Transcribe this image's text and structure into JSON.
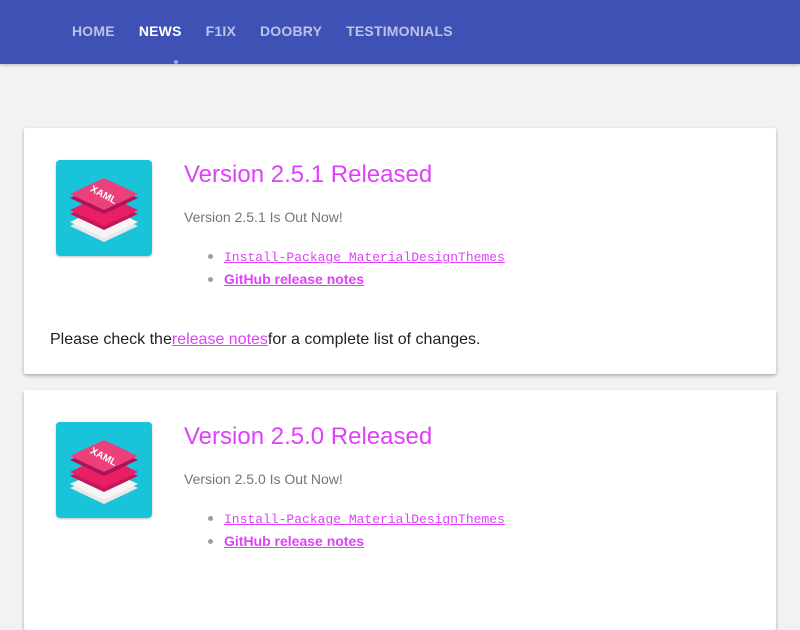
{
  "nav": {
    "items": [
      {
        "label": "HOME"
      },
      {
        "label": "NEWS"
      },
      {
        "label": "F1IX"
      },
      {
        "label": "DOOBRY"
      },
      {
        "label": "TESTIMONIALS"
      }
    ],
    "active": "NEWS"
  },
  "colors": {
    "appbar": "#3f51b5",
    "accent": "#e040fb",
    "logo_bg": "#19c3d9"
  },
  "posts": [
    {
      "title": "Version 2.5.1 Released",
      "subtitle": "Version 2.5.1 Is Out Now!",
      "links": [
        "Install-Package MaterialDesignThemes",
        "GitHub release notes"
      ],
      "body_prefix": "Please check the",
      "body_link": "release notes",
      "body_suffix": "for a complete list of changes.",
      "logo_text": "XAML",
      "logo_icon": "stacked-layers-icon"
    },
    {
      "title": "Version 2.5.0 Released",
      "subtitle": "Version 2.5.0 Is Out Now!",
      "links": [
        "Install-Package MaterialDesignThemes",
        "GitHub release notes"
      ],
      "logo_text": "XAML",
      "logo_icon": "stacked-layers-icon"
    }
  ]
}
